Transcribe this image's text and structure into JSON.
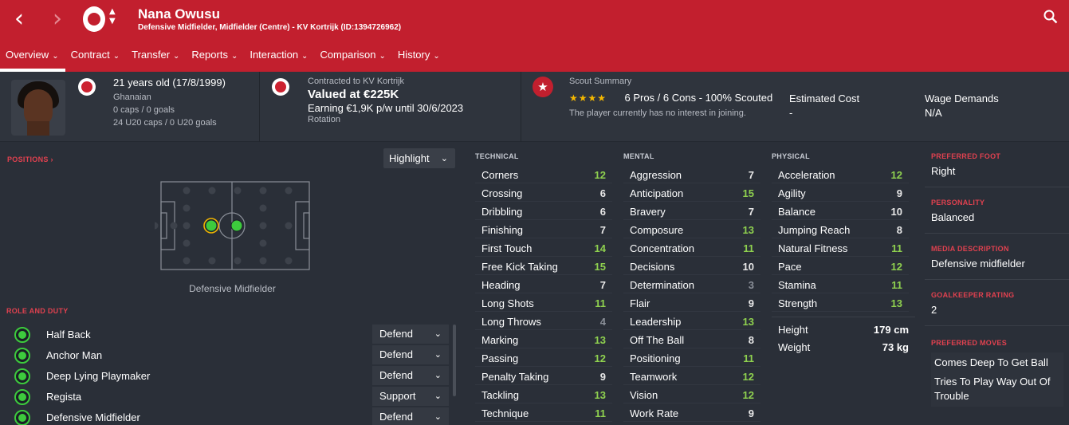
{
  "header": {
    "name": "Nana Owusu",
    "subtitle": "Defensive Midfielder, Midfielder (Centre) - KV Kortrijk (ID:1394726962)",
    "back_icon": "‹",
    "forward_icon": "›",
    "updown_icon": "⌃⌄"
  },
  "tabs": [
    {
      "label": "Overview"
    },
    {
      "label": "Contract"
    },
    {
      "label": "Transfer"
    },
    {
      "label": "Reports"
    },
    {
      "label": "Interaction"
    },
    {
      "label": "Comparison"
    },
    {
      "label": "History"
    }
  ],
  "chevron": "⌄",
  "info": {
    "age": "21 years old (17/8/1999)",
    "nationality": "Ghanaian",
    "caps": "0 caps / 0 goals",
    "u20_caps": "24 U20 caps / 0 U20 goals",
    "contracted": "Contracted to KV Kortrijk",
    "valued": "Valued at €225K",
    "earning": "Earning €1,9K p/w until 30/6/2023",
    "status": "Rotation",
    "scout_title": "Scout Summary",
    "scout_stars": "★★★★",
    "scout_line": "6 Pros / 6 Cons - 100% Scouted",
    "interest": "The player currently has no interest in joining.",
    "est_cost_label": "Estimated Cost",
    "est_cost_value": "-",
    "wage_label": "Wage Demands",
    "wage_value": "N/A"
  },
  "positions": {
    "title": "POSITIONS ›",
    "highlight_label": "Highlight",
    "position_label": "Defensive Midfielder"
  },
  "role_duty": {
    "title": "ROLE AND DUTY",
    "roles": [
      {
        "name": "Half Back",
        "duty": "Defend"
      },
      {
        "name": "Anchor Man",
        "duty": "Defend"
      },
      {
        "name": "Deep Lying Playmaker",
        "duty": "Defend"
      },
      {
        "name": "Regista",
        "duty": "Support"
      },
      {
        "name": "Defensive Midfielder",
        "duty": "Defend"
      }
    ]
  },
  "attributes": {
    "technical": {
      "title": "TECHNICAL",
      "items": [
        {
          "name": "Corners",
          "value": 12
        },
        {
          "name": "Crossing",
          "value": 6
        },
        {
          "name": "Dribbling",
          "value": 6
        },
        {
          "name": "Finishing",
          "value": 7
        },
        {
          "name": "First Touch",
          "value": 14
        },
        {
          "name": "Free Kick Taking",
          "value": 15
        },
        {
          "name": "Heading",
          "value": 7
        },
        {
          "name": "Long Shots",
          "value": 11
        },
        {
          "name": "Long Throws",
          "value": 4
        },
        {
          "name": "Marking",
          "value": 13
        },
        {
          "name": "Passing",
          "value": 12
        },
        {
          "name": "Penalty Taking",
          "value": 9
        },
        {
          "name": "Tackling",
          "value": 13
        },
        {
          "name": "Technique",
          "value": 11
        }
      ]
    },
    "mental": {
      "title": "MENTAL",
      "items": [
        {
          "name": "Aggression",
          "value": 7
        },
        {
          "name": "Anticipation",
          "value": 15
        },
        {
          "name": "Bravery",
          "value": 7
        },
        {
          "name": "Composure",
          "value": 13
        },
        {
          "name": "Concentration",
          "value": 11
        },
        {
          "name": "Decisions",
          "value": 10
        },
        {
          "name": "Determination",
          "value": 3
        },
        {
          "name": "Flair",
          "value": 9
        },
        {
          "name": "Leadership",
          "value": 13
        },
        {
          "name": "Off The Ball",
          "value": 8
        },
        {
          "name": "Positioning",
          "value": 11
        },
        {
          "name": "Teamwork",
          "value": 12
        },
        {
          "name": "Vision",
          "value": 12
        },
        {
          "name": "Work Rate",
          "value": 9
        }
      ]
    },
    "physical": {
      "title": "PHYSICAL",
      "items": [
        {
          "name": "Acceleration",
          "value": 12
        },
        {
          "name": "Agility",
          "value": 9
        },
        {
          "name": "Balance",
          "value": 10
        },
        {
          "name": "Jumping Reach",
          "value": 8
        },
        {
          "name": "Natural Fitness",
          "value": 11
        },
        {
          "name": "Pace",
          "value": 12
        },
        {
          "name": "Stamina",
          "value": 11
        },
        {
          "name": "Strength",
          "value": 13
        }
      ],
      "height_label": "Height",
      "height_value": "179 cm",
      "weight_label": "Weight",
      "weight_value": "73 kg"
    }
  },
  "side": {
    "foot_label": "PREFERRED FOOT",
    "foot_value": "Right",
    "personality_label": "PERSONALITY",
    "personality_value": "Balanced",
    "media_label": "MEDIA DESCRIPTION",
    "media_value": "Defensive midfielder",
    "gk_label": "GOALKEEPER RATING",
    "gk_value": "2",
    "moves_label": "PREFERRED MOVES",
    "moves": [
      "Comes Deep To Get Ball",
      "Tries To Play Way Out Of Trouble"
    ]
  },
  "colors": {
    "header_red": "#c21f2e",
    "attr_high": "#8fd14f",
    "attr_mid": "#e8e8e8",
    "attr_low": "#8a8f98"
  }
}
